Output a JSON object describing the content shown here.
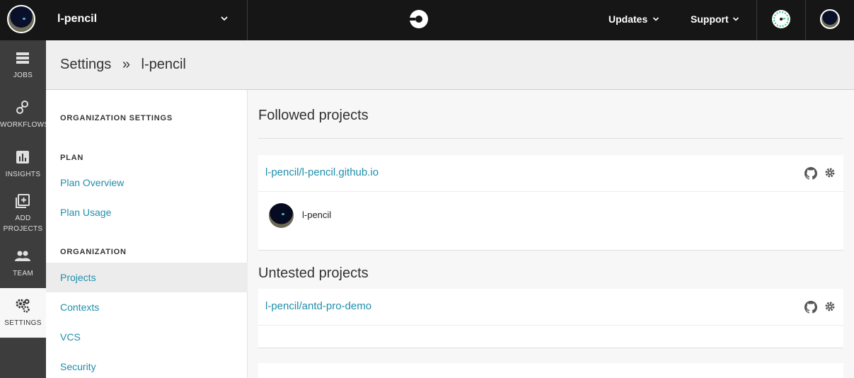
{
  "topbar": {
    "org_name": "l-pencil",
    "updates_label": "Updates",
    "support_label": "Support"
  },
  "leftnav": {
    "items": [
      {
        "label": "JOBS",
        "icon": "jobs-list-icon"
      },
      {
        "label": "WORKFLOWS",
        "icon": "workflows-icon"
      },
      {
        "label": "INSIGHTS",
        "icon": "insights-chart-icon"
      },
      {
        "label_line1": "ADD",
        "label_line2": "PROJECTS",
        "icon": "add-projects-icon"
      },
      {
        "label": "TEAM",
        "icon": "team-icon"
      },
      {
        "label": "SETTINGS",
        "icon": "settings-gears-icon"
      }
    ]
  },
  "header": {
    "breadcrumb_root": "Settings",
    "breadcrumb_sep": "»",
    "breadcrumb_current": "l-pencil"
  },
  "sidebar": {
    "org_settings_heading": "ORGANIZATION SETTINGS",
    "plan_heading": "PLAN",
    "plan_links": [
      "Plan Overview",
      "Plan Usage"
    ],
    "org_heading": "ORGANIZATION",
    "org_links": [
      "Projects",
      "Contexts",
      "VCS",
      "Security"
    ]
  },
  "main": {
    "followed_title": "Followed projects",
    "followed": [
      {
        "name": "l-pencil/l-pencil.github.io",
        "follower": "l-pencil"
      }
    ],
    "untested_title": "Untested projects",
    "untested": [
      {
        "name": "l-pencil/antd-pro-demo"
      }
    ]
  },
  "colors": {
    "topbar_bg": "#161616",
    "leftnav_bg": "#3d3d3d",
    "link": "#1f8fab",
    "accent_green": "#42c88a"
  }
}
